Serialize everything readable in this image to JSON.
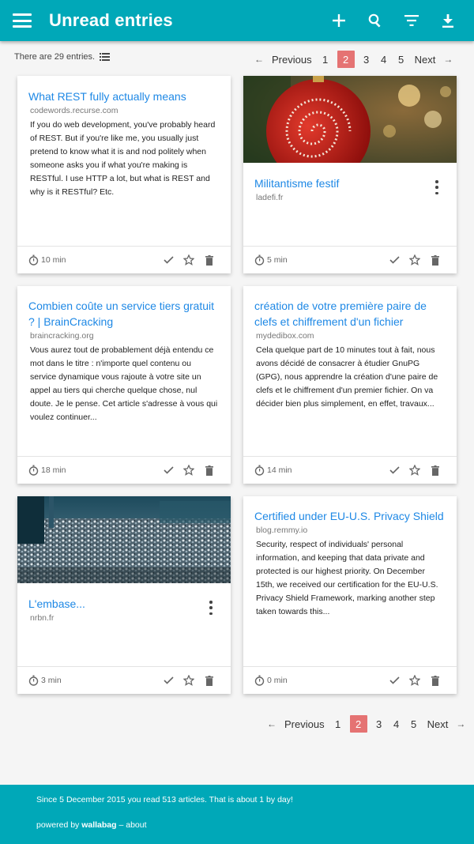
{
  "header": {
    "title": "Unread entries",
    "actions": [
      "plus-icon",
      "search-icon",
      "filter-icon",
      "download-icon"
    ]
  },
  "info": {
    "count_text": "There are 29 entries."
  },
  "pagination": {
    "previous": "Previous",
    "next": "Next",
    "pages": [
      "1",
      "2",
      "3",
      "4",
      "5"
    ],
    "current": "2"
  },
  "entries": [
    {
      "title": "What REST fully actually means",
      "domain": "codewords.recurse.com",
      "excerpt": "If you do web development, you've probably heard of REST. But if you're like me, you usually just pretend to know what it is and nod politely when someone asks you if what you're making is RESTful. I use HTTP a lot, but what is REST and why is it RESTful? Etc.",
      "time": "10 min",
      "has_image": false
    },
    {
      "title": "Militantisme festif",
      "domain": "ladefi.fr",
      "excerpt": "",
      "time": "5 min",
      "has_image": true
    },
    {
      "title": "Combien coûte un service tiers gratuit ? | BrainCracking",
      "domain": "braincracking.org",
      "excerpt": "Vous aurez tout de probablement déjà entendu ce mot dans le titre : n'importe quel contenu ou service dynamique vous rajoute à votre site un appel au tiers qui cherche quelque chose, nul doute. Je le pense. Cet article s'adresse à vous qui voulez continuer...",
      "time": "18 min",
      "has_image": false
    },
    {
      "title": "création de votre première paire de clefs et chiffrement d'un fichier",
      "domain": "mydedibox.com",
      "excerpt": "Cela quelque part de 10 minutes tout à fait, nous avons décidé de consacrer à étudier GnuPG (GPG), nous apprendre la création d'une paire de clefs et le chiffrement d'un premier fichier. On va décider bien plus simplement, en effet, travaux...",
      "time": "14 min",
      "has_image": false
    },
    {
      "title": "L'embase...",
      "domain": "nrbn.fr",
      "excerpt": "",
      "time": "3 min",
      "has_image": true
    },
    {
      "title": "Certified under EU-U.S. Privacy Shield",
      "domain": "blog.remmy.io",
      "excerpt": "Security, respect of individuals' personal information, and keeping that data private and protected is our highest priority. On December 15th, we received our certification for the EU-U.S. Privacy Shield Framework, marking another step taken towards this...",
      "time": "0 min",
      "has_image": false
    }
  ],
  "footer": {
    "stats": "Since 5 December 2015 you read 513 articles. That is about 1 by day!",
    "powered_prefix": "powered by",
    "brand": "wallabag",
    "about": "about",
    "separator": " – "
  },
  "colors": {
    "primary": "#00a8b8",
    "link": "#1e88e5",
    "current_page": "#e57373"
  }
}
